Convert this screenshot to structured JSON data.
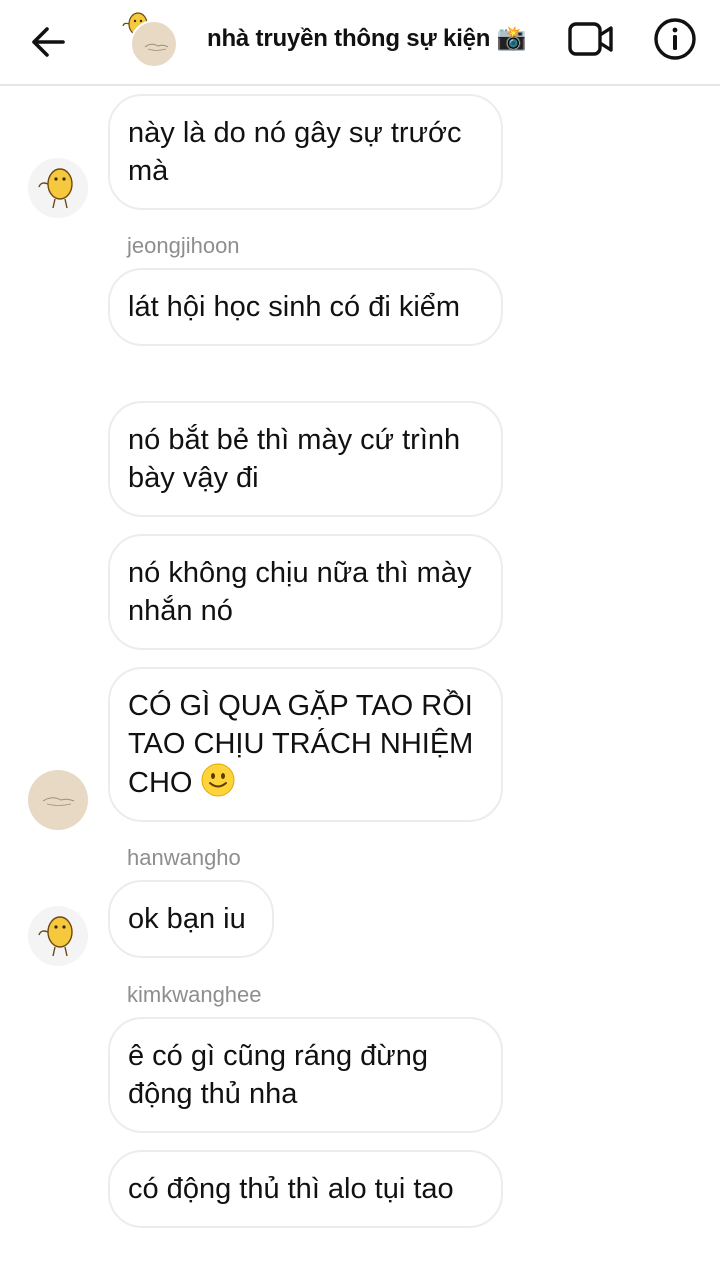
{
  "header": {
    "title": "nhà truyền thông sự kiện 📸",
    "back_icon": "arrow-left-icon",
    "video_icon": "video-camera-icon",
    "info_icon": "info-icon"
  },
  "colors": {
    "bubble_border": "#ececec",
    "sender_text": "#8e8e8e",
    "avatar_beige": "#e7d9c3",
    "potato_yellow": "#f6c83d"
  },
  "messages": [
    {
      "text": "này là do nó gây sự trước mà"
    },
    {
      "sender": "jeongjihoon",
      "text": "lát hội học sinh có đi kiểm"
    },
    {
      "text": "nó bắt bẻ thì mày cứ trình bày vậy đi"
    },
    {
      "text": "nó không chịu nữa thì mày nhắn nó"
    },
    {
      "text": "CÓ GÌ QUA GẶP TAO RỒI TAO CHỊU TRÁCH NHIỆM CHO",
      "emoji": "slightly-smiling-face-icon"
    },
    {
      "sender": "hanwangho",
      "text": "ok bạn iu"
    },
    {
      "sender": "kimkwanghee",
      "text": "ê có gì cũng ráng đừng động thủ nha"
    },
    {
      "text": "có động thủ thì alo tụi tao"
    }
  ]
}
